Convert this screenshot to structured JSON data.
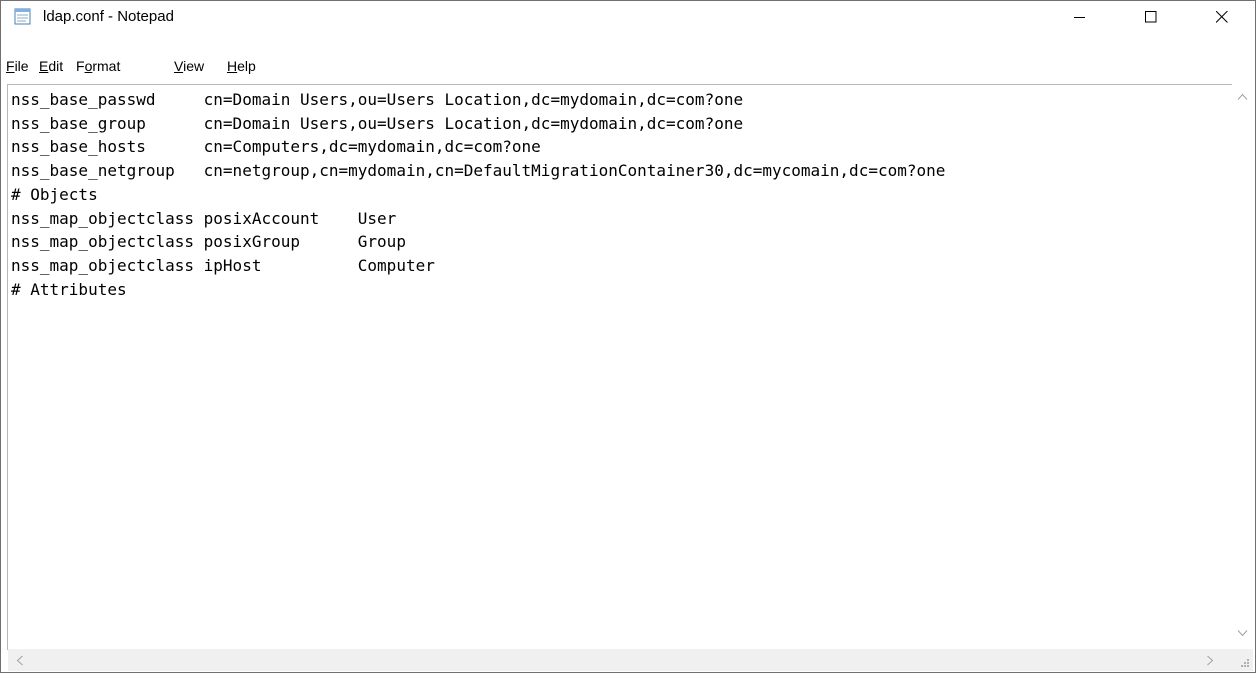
{
  "window": {
    "title": "ldap.conf - Notepad",
    "icon": "notepad-icon"
  },
  "caption_buttons": {
    "minimize": "minimize-icon",
    "maximize": "maximize-icon",
    "close": "close-icon"
  },
  "menu": {
    "items": [
      {
        "first": "F",
        "rest": "ile"
      },
      {
        "first": "E",
        "rest": "dit"
      },
      {
        "pre": "F",
        "first": "o",
        "rest": "rmat"
      },
      {
        "first": "V",
        "rest": "iew"
      },
      {
        "first": "H",
        "rest": "elp"
      }
    ]
  },
  "editor": {
    "lines": [
      "nss_base_passwd     cn=Domain Users,ou=Users Location,dc=mydomain,dc=com?one",
      "nss_base_group      cn=Domain Users,ou=Users Location,dc=mydomain,dc=com?one",
      "nss_base_hosts      cn=Computers,dc=mydomain,dc=com?one",
      "nss_base_netgroup   cn=netgroup,cn=mydomain,cn=DefaultMigrationContainer30,dc=mycomain,dc=com?one",
      "# Objects",
      "nss_map_objectclass posixAccount    User",
      "nss_map_objectclass posixGroup      Group",
      "nss_map_objectclass ipHost          Computer",
      "# Attributes"
    ]
  },
  "colors": {
    "window_border": "#707070",
    "scrollbar_track": "#f0f0f0",
    "arrow": "#a0a0a0"
  }
}
